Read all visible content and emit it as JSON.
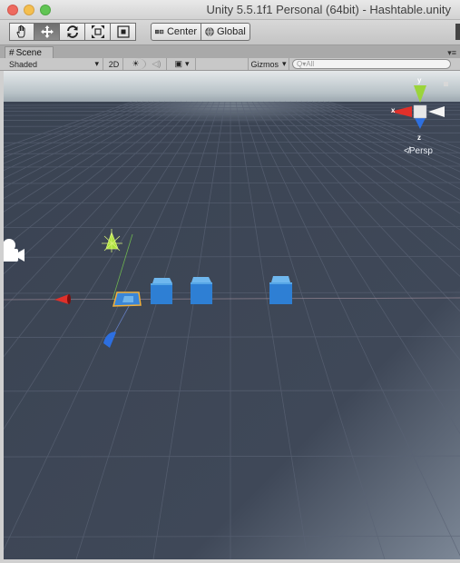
{
  "window": {
    "title": "Unity 5.5.1f1 Personal (64bit) - Hashtable.unity"
  },
  "toolbar": {
    "tools": [
      {
        "name": "hand-tool",
        "icon": "hand-icon"
      },
      {
        "name": "move-tool",
        "icon": "move-arrows-icon",
        "active": true
      },
      {
        "name": "rotate-tool",
        "icon": "rotate-icon"
      },
      {
        "name": "scale-tool",
        "icon": "scale-icon"
      },
      {
        "name": "rect-tool",
        "icon": "rect-icon"
      }
    ],
    "pivot_label": "Center",
    "rotation_label": "Global"
  },
  "tab": {
    "label": "Scene",
    "icon": "scene-grid-icon"
  },
  "scene_toolbar": {
    "shading": "Shaded",
    "mode_2d": "2D",
    "gizmos": "Gizmos",
    "search_placeholder": "Q▾All"
  },
  "orientation_gizmo": {
    "x": "x",
    "y": "y",
    "z": "z",
    "view": "Persp"
  },
  "colors": {
    "sky": "#bfc8cc",
    "ground": "#3d4656",
    "grid": "#5b6475",
    "cube": "#2f7fd6",
    "x_axis": "#e0302a",
    "y_axis": "#9bd43b",
    "z_axis": "#2d6fe0"
  }
}
